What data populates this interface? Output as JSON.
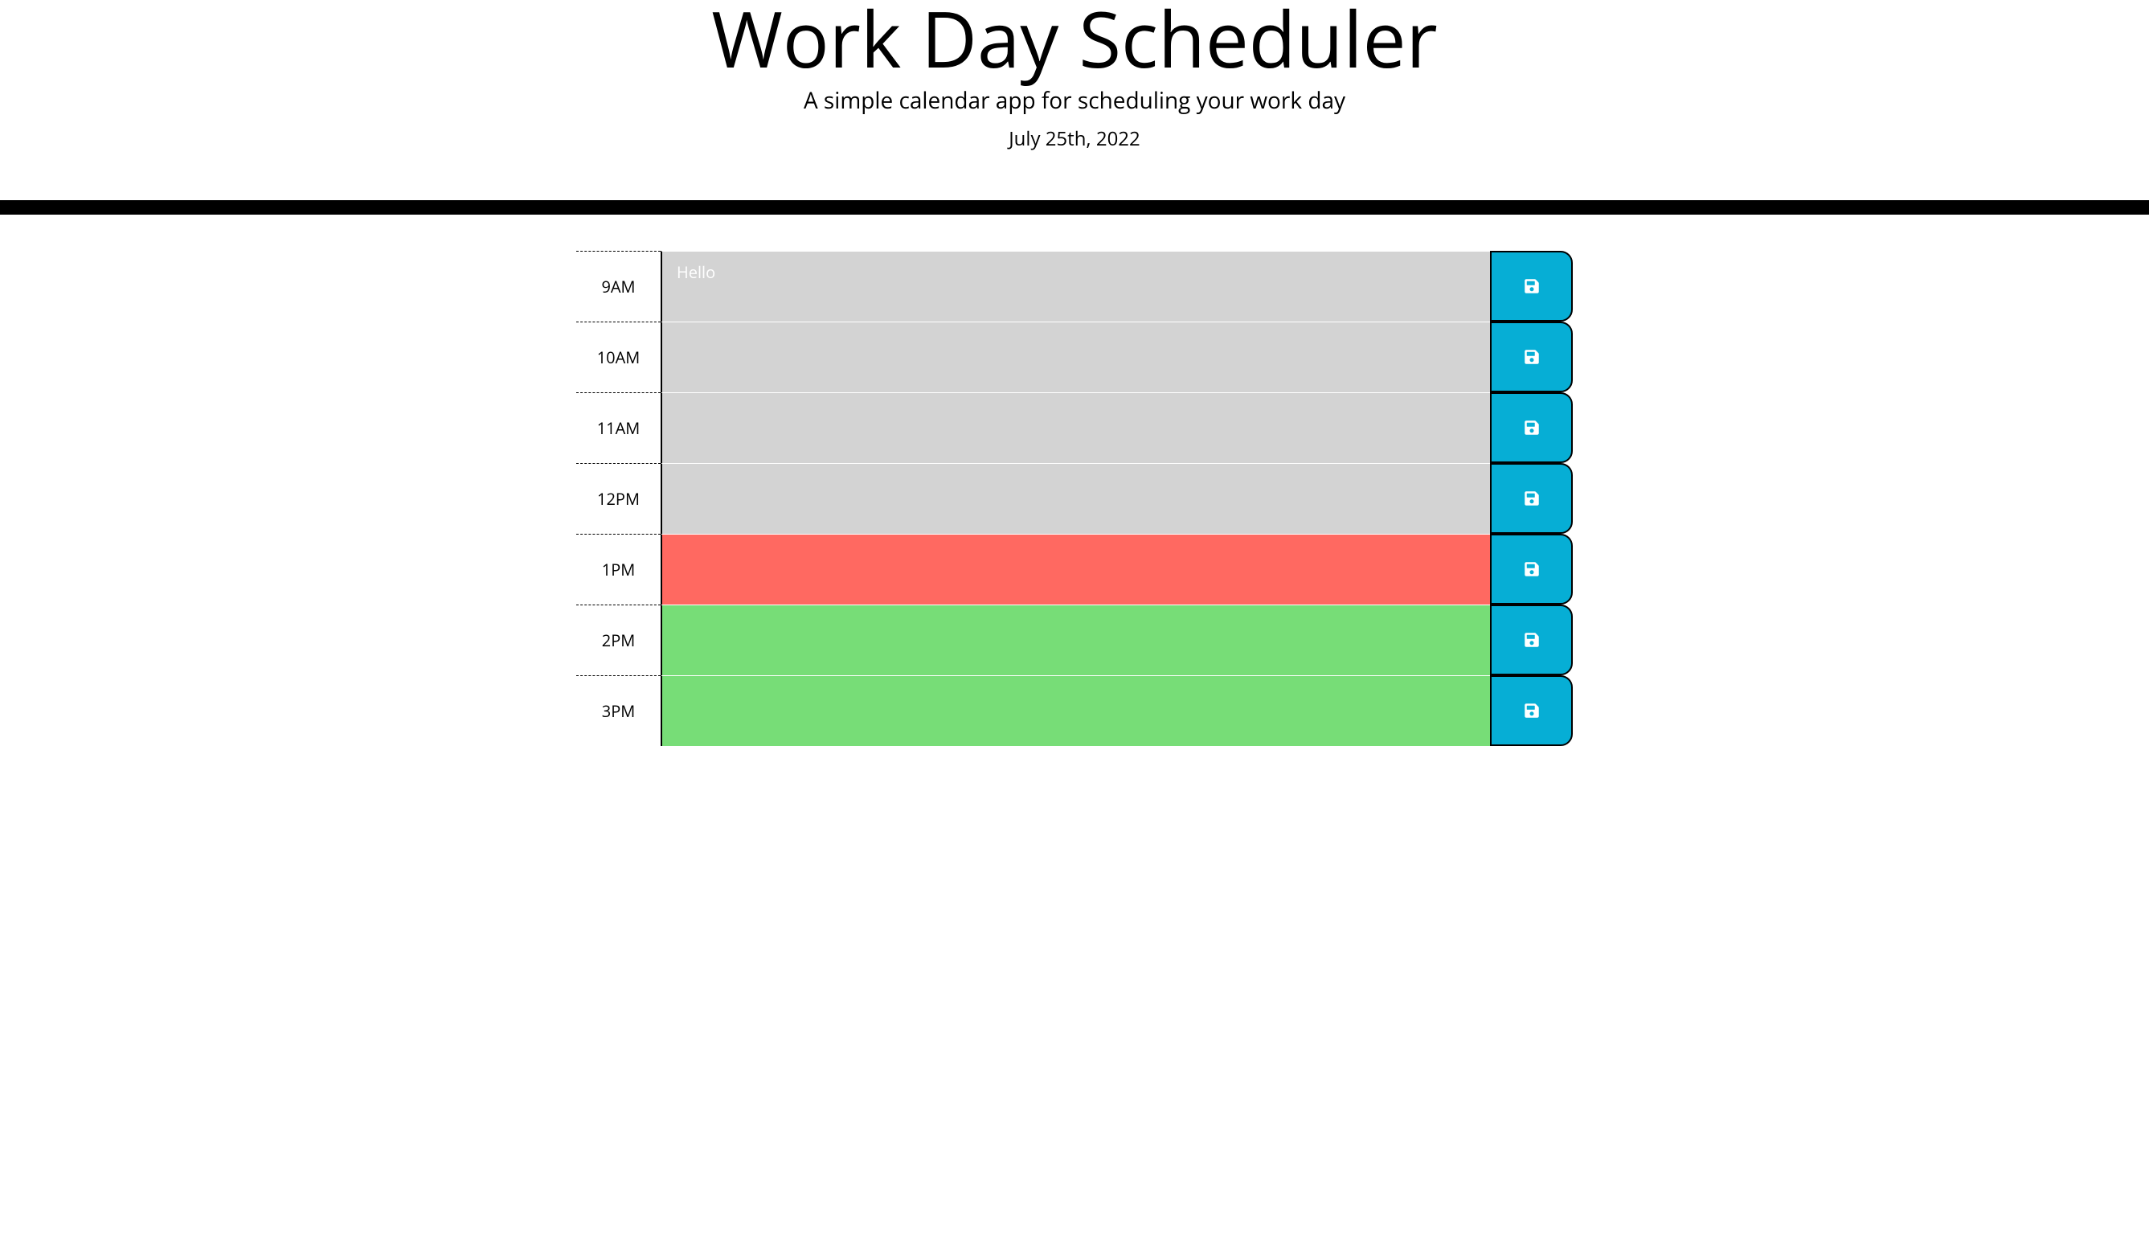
{
  "header": {
    "title": "Work Day Scheduler",
    "subtitle": "A simple calendar app for scheduling your work day",
    "date": "July 25th, 2022"
  },
  "timeblocks": [
    {
      "hour": "9AM",
      "text": "Hello",
      "state": "past"
    },
    {
      "hour": "10AM",
      "text": "",
      "state": "past"
    },
    {
      "hour": "11AM",
      "text": "",
      "state": "past"
    },
    {
      "hour": "12PM",
      "text": "",
      "state": "past"
    },
    {
      "hour": "1PM",
      "text": "",
      "state": "present"
    },
    {
      "hour": "2PM",
      "text": "",
      "state": "future"
    },
    {
      "hour": "3PM",
      "text": "",
      "state": "future"
    }
  ]
}
